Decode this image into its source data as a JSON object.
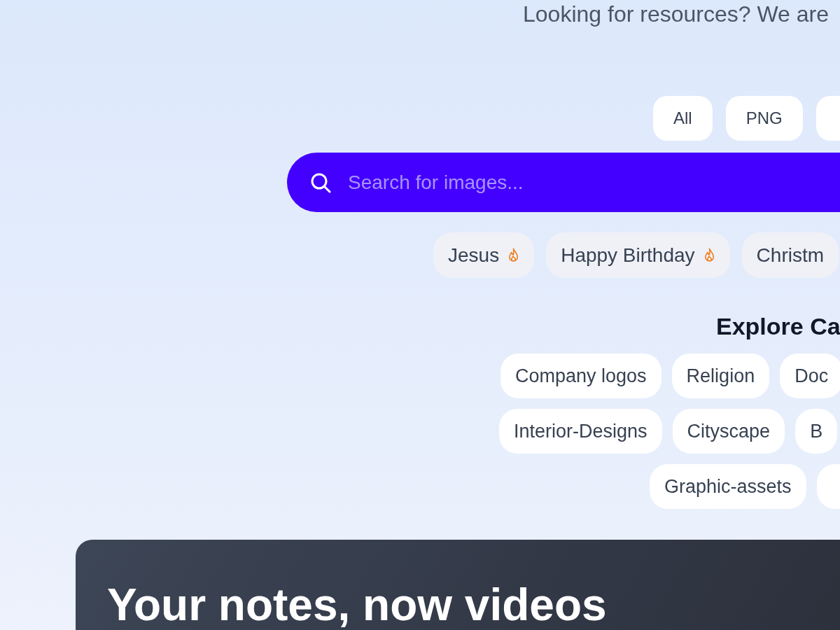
{
  "tagline": "Looking for resources? We are",
  "filters": {
    "items": [
      {
        "label": "All"
      },
      {
        "label": "PNG"
      }
    ],
    "more_cut_off": true
  },
  "search": {
    "placeholder": "Search for images..."
  },
  "trending": [
    {
      "label": "Jesus",
      "hot": true
    },
    {
      "label": "Happy Birthday",
      "hot": true
    },
    {
      "label": "Christm",
      "hot": false
    }
  ],
  "categories": {
    "title": "Explore Ca",
    "items": [
      "Company logos",
      "Religion",
      "Doc",
      "Interior-Designs",
      "Cityscape",
      "B",
      "Graphic-assets"
    ],
    "more_cut_off": true
  },
  "promo": {
    "title": "Your notes, now videos"
  }
}
